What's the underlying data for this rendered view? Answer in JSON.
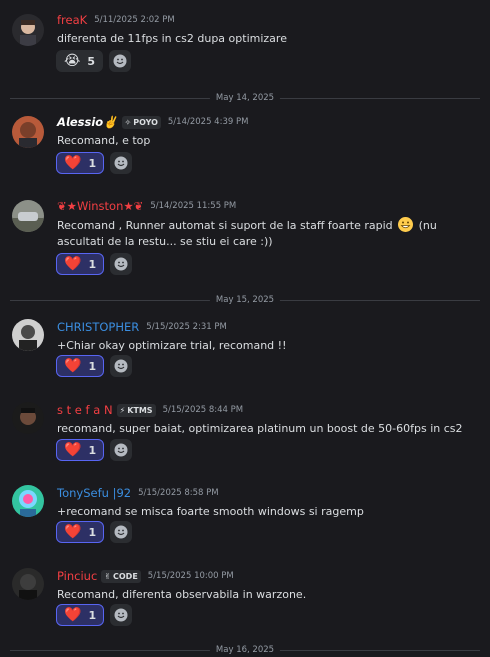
{
  "messages": [
    {
      "username": "freaK",
      "name_color": "#f23f43",
      "timestamp": "5/11/2025 2:02 PM",
      "content": "diferenta de 11fps in cs2 dupa optimizare",
      "reaction": {
        "emoji": "😭",
        "count": "5",
        "active": false
      }
    },
    {
      "username": "𝘼𝙡𝙚𝙨𝙨𝙞𝙤✌️",
      "name_color": "#ffffff",
      "tag": "POYO",
      "tag_icon": "✧",
      "timestamp": "5/14/2025 4:39 PM",
      "content": "Recomand, e top",
      "reaction": {
        "emoji": "❤️",
        "count": "1",
        "active": true
      }
    },
    {
      "username": "❦★Winston★❦",
      "name_color": "#f23f43",
      "timestamp": "5/14/2025 11:55 PM",
      "content": "Recomand ,  Runner automat si suport de la staff foarte rapid",
      "content_tail": " (nu ascultati de la restu... se stiu ei care :))",
      "reaction": {
        "emoji": "❤️",
        "count": "1",
        "active": true
      }
    },
    {
      "username": "CHRISTOPHER",
      "name_color": "#3b8ee0",
      "timestamp": "5/15/2025 2:31 PM",
      "content": "+Chiar okay optimizare trial, recomand !!",
      "reaction": {
        "emoji": "❤️",
        "count": "1",
        "active": true
      }
    },
    {
      "username": "s t e f a N",
      "name_color": "#f23f43",
      "tag": "KTMS",
      "tag_icon": "⚡",
      "timestamp": "5/15/2025 8:44 PM",
      "content": "recomand, super baiat, optimizarea platinum un boost de 50-60fps in cs2",
      "reaction": {
        "emoji": "❤️",
        "count": "1",
        "active": true
      }
    },
    {
      "username": "TonySefu |92",
      "name_color": "#3b8ee0",
      "timestamp": "5/15/2025 8:58 PM",
      "content": "+recomand se misca foarte smooth windows si ragemp",
      "reaction": {
        "emoji": "❤️",
        "count": "1",
        "active": true
      }
    },
    {
      "username": "Pinciuc",
      "name_color": "#f23f43",
      "tag": "CODE",
      "tag_icon": "✌",
      "timestamp": "5/15/2025 10:00 PM",
      "content": "Recomand, diferenta observabila in warzone.",
      "reaction": {
        "emoji": "❤️",
        "count": "1",
        "active": true
      }
    }
  ],
  "dividers": [
    "May 14, 2025",
    "May 15, 2025",
    "May 16, 2025"
  ],
  "colors": {
    "background": "#1a1a1e",
    "accent": "#5865f2",
    "heart": "#e8364f"
  }
}
